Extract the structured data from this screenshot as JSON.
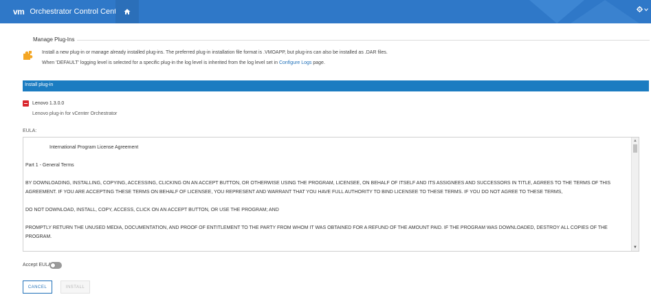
{
  "header": {
    "logo": "vm",
    "title": "Orchestrator Control Center",
    "home_icon": "home-icon",
    "settings_icon": "gear-icon",
    "accent": "#2f78c8"
  },
  "manage": {
    "title": "Manage Plug-Ins",
    "line1": "Install a new plug-in or manage already installed plug-ins. The preferred plug-in installation file format is .VMOAPP, but plug-ins can also be installed as .DAR files.",
    "line2_prefix": "When 'DEFAULT' logging level is selected for a specific plug-in the log level is inherited from the log level set in ",
    "line2_link": "Configure Logs",
    "line2_suffix": " page."
  },
  "install_bar": {
    "label": "Install plug-in",
    "color": "#1b7cc1"
  },
  "plugin": {
    "name": "Lenovo",
    "version": "1.3.0.0",
    "description": "Lenovo plug-in for vCenter Orchestrator"
  },
  "eula": {
    "label": "EULA:",
    "paragraphs": [
      "International Program License Agreement",
      "Part 1 - General Terms",
      "BY DOWNLOADING, INSTALLING, COPYING, ACCESSING, CLICKING ON AN ACCEPT BUTTON, OR OTHERWISE USING THE PROGRAM, LICENSEE, ON BEHALF OF ITSELF AND ITS ASSIGNEES AND SUCCESSORS IN TITLE, AGREES TO THE TERMS OF THIS AGREEMENT.  IF YOU ARE ACCEPTING THESE TERMS ON BEHALF OF LICENSEE, YOU REPRESENT AND WARRANT THAT YOU HAVE FULL AUTHORITY TO BIND LICENSEE TO THESE TERMS.  IF YOU DO NOT AGREE TO THESE TERMS,",
      "DO NOT DOWNLOAD, INSTALL, COPY, ACCESS, CLICK ON AN ACCEPT BUTTON, OR USE THE PROGRAM; AND",
      "PROMPTLY RETURN THE UNUSED MEDIA, DOCUMENTATION, AND PROOF OF ENTITLEMENT TO THE PARTY FROM WHOM IT WAS OBTAINED FOR A REFUND OF THE AMOUNT PAID.  IF THE PROGRAM WAS DOWNLOADED, DESTROY ALL COPIES OF THE PROGRAM."
    ]
  },
  "accept": {
    "label": "Accept EULA",
    "enabled": false
  },
  "buttons": {
    "cancel": "CANCEL",
    "install": "INSTALL"
  }
}
